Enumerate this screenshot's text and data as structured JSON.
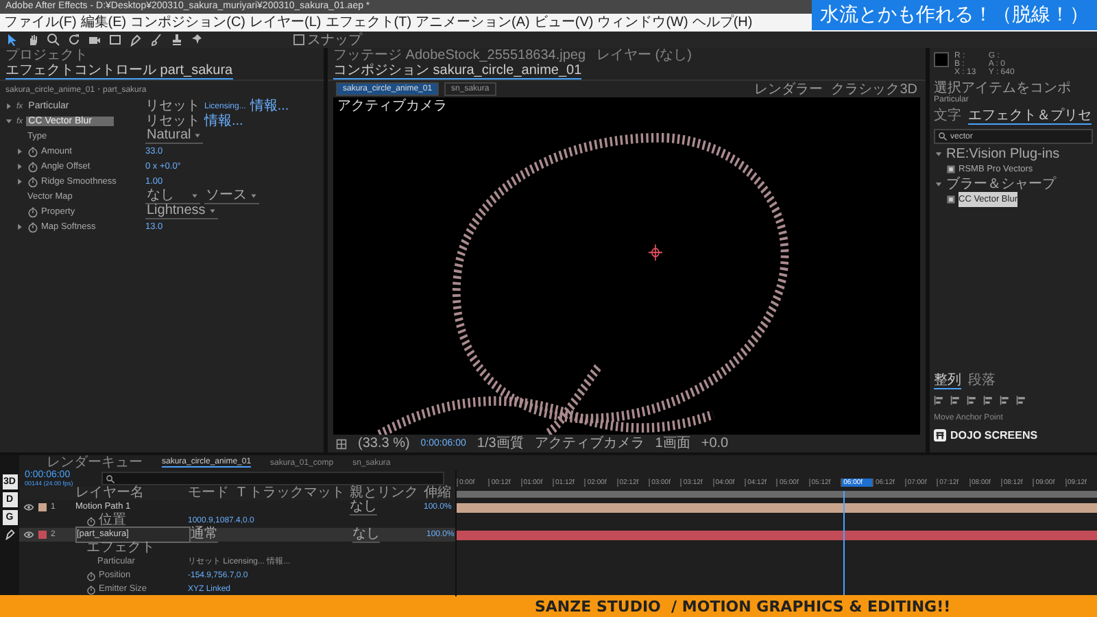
{
  "window": {
    "title": "Adobe After Effects - D:¥Desktop¥200310_sakura_muriyari¥200310_sakura_01.aep *"
  },
  "menu": [
    "ファイル(F)",
    "編集(E)",
    "コンポジション(C)",
    "レイヤー(L)",
    "エフェクト(T)",
    "アニメーション(A)",
    "ビュー(V)",
    "ウィンドウ(W)",
    "ヘルプ(H)"
  ],
  "banner": {
    "text": "水流とかも作れる！（脱線！）"
  },
  "toolbar": {
    "snap_label": "スナップ",
    "snap_checked": false
  },
  "effect_controls": {
    "tabs": [
      {
        "label": "プロジェクト",
        "selected": false
      },
      {
        "label": "エフェクトコントロール part_sakura",
        "selected": true
      }
    ],
    "breadcrumb": "sakura_circle_anime_01・part_sakura",
    "effects": [
      {
        "icon_label": "fx",
        "name": "Particular",
        "links": [
          "リセット",
          "Licensing...",
          "情報..."
        ],
        "selected": false
      },
      {
        "icon_label": "fx",
        "name": "CC Vector Blur",
        "links": [
          "リセット",
          "情報..."
        ],
        "selected": true
      }
    ],
    "properties": [
      {
        "label": "Type",
        "kind": "dropdown",
        "values": [
          "Natural"
        ],
        "animatable": false
      },
      {
        "label": "Amount",
        "kind": "number",
        "values": [
          "33.0"
        ],
        "animatable": true
      },
      {
        "label": "Angle Offset",
        "kind": "number",
        "values": [
          "0 x +0.0°"
        ],
        "animatable": true
      },
      {
        "label": "Ridge Smoothness",
        "kind": "number",
        "values": [
          "1.00"
        ],
        "animatable": true
      },
      {
        "label": "Vector Map",
        "kind": "dropdown",
        "values": [
          "なし",
          "ソース"
        ],
        "animatable": false
      },
      {
        "label": "Property",
        "kind": "dropdown",
        "values": [
          "Lightness"
        ],
        "animatable": true
      },
      {
        "label": "Map Softness",
        "kind": "number",
        "values": [
          "13.0"
        ],
        "animatable": true
      }
    ]
  },
  "composition": {
    "tabs": [
      {
        "label": "フッテージ AdobeStock_255518634.jpeg",
        "selected": false
      },
      {
        "label": "レイヤー (なし)",
        "selected": false
      },
      {
        "label": "コンポジション sakura_circle_anime_01",
        "selected": true
      }
    ],
    "subtabs": [
      {
        "label": "sakura_circle_anime_01",
        "selected": true
      },
      {
        "label": "sn_sakura",
        "selected": false
      }
    ],
    "renderer_label": "レンダラー",
    "renderer_value": "クラシック3D",
    "camera_label": "アクティブカメラ",
    "viewer_bar": [
      "(33.3 %)",
      "0:00:06:00",
      "1/3画質",
      "アクティブカメラ",
      "1画面",
      "+0.0"
    ]
  },
  "right_panel": {
    "info": [
      "R :",
      "G :",
      "B :",
      "A : 0",
      "X : 13",
      "Y : 640"
    ],
    "hint": "選択アイテムをコンポ",
    "hint_item": "Particular",
    "tabs": [
      {
        "label": "文字",
        "selected": false
      },
      {
        "label": "エフェクト＆プリセ",
        "selected": true
      }
    ],
    "search": "vector",
    "tree": [
      {
        "label": "RE:Vision Plug-ins",
        "expanded": true,
        "selected": false,
        "children": [
          {
            "label": "RSMB Pro Vectors",
            "selected": false
          }
        ]
      },
      {
        "label": "ブラー＆シャープ",
        "expanded": true,
        "selected": false,
        "children": [
          {
            "label": "CC Vector Blur",
            "selected": true
          }
        ]
      }
    ],
    "align_tabs": [
      {
        "label": "整列",
        "selected": true
      },
      {
        "label": "段落",
        "selected": false
      }
    ],
    "script_title": "Move Anchor Point",
    "logo": "DOJO SCREENS"
  },
  "timeline": {
    "tabs": [
      {
        "label": "レンダーキュー",
        "selected": false
      },
      {
        "label": "sakura_circle_anime_01",
        "selected": true
      },
      {
        "label": "sakura_01_comp",
        "selected": false
      },
      {
        "label": "sn_sakura",
        "selected": false
      }
    ],
    "timecode": "0:00:06:00",
    "frames": "00144 (24.00 fps)",
    "side_tools": [
      "3D",
      "D",
      "G"
    ],
    "columns": [
      "レイヤー名",
      "モード",
      "T トラックマット",
      "親とリンク",
      "伸縮"
    ],
    "rows": [
      {
        "kind": "layer",
        "number": "1",
        "name": "Motion Path 1",
        "color": "#c9a48c",
        "parent": "なし",
        "stretch": "100.0%",
        "selected": false
      },
      {
        "kind": "property",
        "name": "位置",
        "value": "1000.9,1087.4,0.0"
      },
      {
        "kind": "layer",
        "number": "2",
        "name": "[part_sakura]",
        "color": "#c44c58",
        "mode": "通常",
        "parent": "なし",
        "stretch": "100.0%",
        "selected": true
      },
      {
        "kind": "group",
        "name": "エフェクト"
      },
      {
        "kind": "effect",
        "name": "Particular",
        "value": "リセット Licensing... 情報..."
      },
      {
        "kind": "property",
        "name": "Position",
        "value": "-154.9,756.7,0.0"
      },
      {
        "kind": "property",
        "name": "Emitter Size",
        "value": "XYZ Linked"
      }
    ],
    "ruler": [
      {
        "label": "0:00f",
        "selected": false
      },
      {
        "label": "00:12f",
        "selected": false
      },
      {
        "label": "01:00f",
        "selected": false
      },
      {
        "label": "01:12f",
        "selected": false
      },
      {
        "label": "02:00f",
        "selected": false
      },
      {
        "label": "02:12f",
        "selected": false
      },
      {
        "label": "03:00f",
        "selected": false
      },
      {
        "label": "03:12f",
        "selected": false
      },
      {
        "label": "04:00f",
        "selected": false
      },
      {
        "label": "04:12f",
        "selected": false
      },
      {
        "label": "05:00f",
        "selected": false
      },
      {
        "label": "05:12f",
        "selected": false
      },
      {
        "label": "06:00f",
        "selected": true
      },
      {
        "label": "06:12f",
        "selected": false
      },
      {
        "label": "07:00f",
        "selected": false
      },
      {
        "label": "07:12f",
        "selected": false
      },
      {
        "label": "08:00f",
        "selected": false
      },
      {
        "label": "08:12f",
        "selected": false
      },
      {
        "label": "09:00f",
        "selected": false
      },
      {
        "label": "09:12f",
        "selected": false
      }
    ]
  },
  "footer": {
    "text": "SANZE STUDIO  / MOTION GRAPHICS & EDITING!!"
  }
}
